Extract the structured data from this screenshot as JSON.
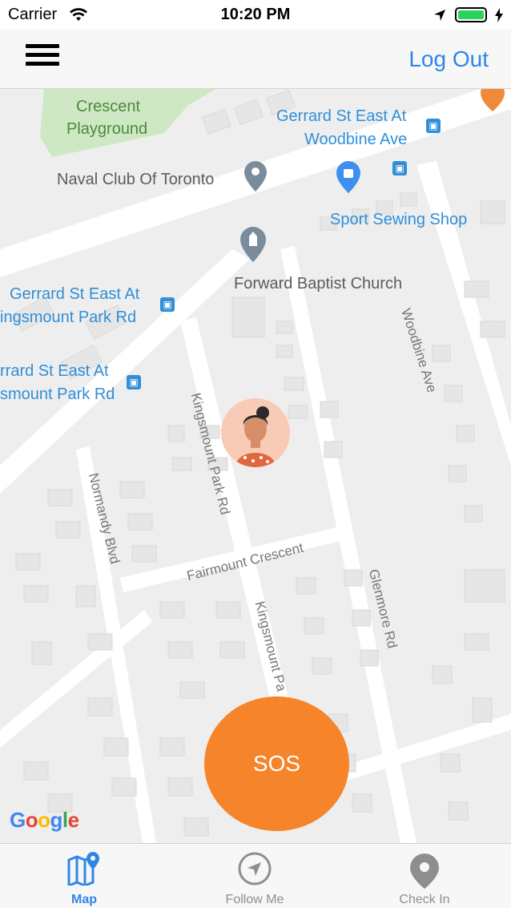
{
  "status_bar": {
    "carrier": "Carrier",
    "time": "10:20 PM"
  },
  "nav": {
    "logout_label": "Log Out"
  },
  "map": {
    "pois": {
      "playground_line1": "Crescent",
      "playground_line2": "Playground",
      "naval_club": "Naval Club Of Toronto",
      "sport_sewing": "Sport Sewing Shop",
      "forward_baptist": "Forward Baptist Church"
    },
    "transit": {
      "gerrard_woodbine_line1": "Gerrard St East At",
      "gerrard_woodbine_line2": "Woodbine Ave",
      "gerrard_kingsmount_a_line1": "Gerrard St East At",
      "gerrard_kingsmount_a_line2": "ingsmount Park Rd",
      "gerrard_kingsmount_b_line1": "rrard St East At",
      "gerrard_kingsmount_b_line2": "smount Park Rd"
    },
    "streets": {
      "woodbine": "Woodbine Ave",
      "kingsmount_north": "Kingsmount Park Rd",
      "kingsmount_south": "Kingsmount Pa",
      "normandy": "Normandy Blvd",
      "fairmount": "Fairmount Crescent",
      "glenmore": "Glenmore Rd"
    },
    "attribution": "Google"
  },
  "sos_label": "SOS",
  "tabs": [
    {
      "label": "Map",
      "icon": "map-icon",
      "active": true
    },
    {
      "label": "Follow Me",
      "icon": "navigation-arrow-icon",
      "active": false
    },
    {
      "label": "Check In",
      "icon": "location-pin-icon",
      "active": false
    }
  ],
  "colors": {
    "accent_blue": "#2f86e8",
    "sos_orange": "#f5842a",
    "inactive_gray": "#8e8e8e",
    "transit_blue": "#2f8fd8"
  }
}
